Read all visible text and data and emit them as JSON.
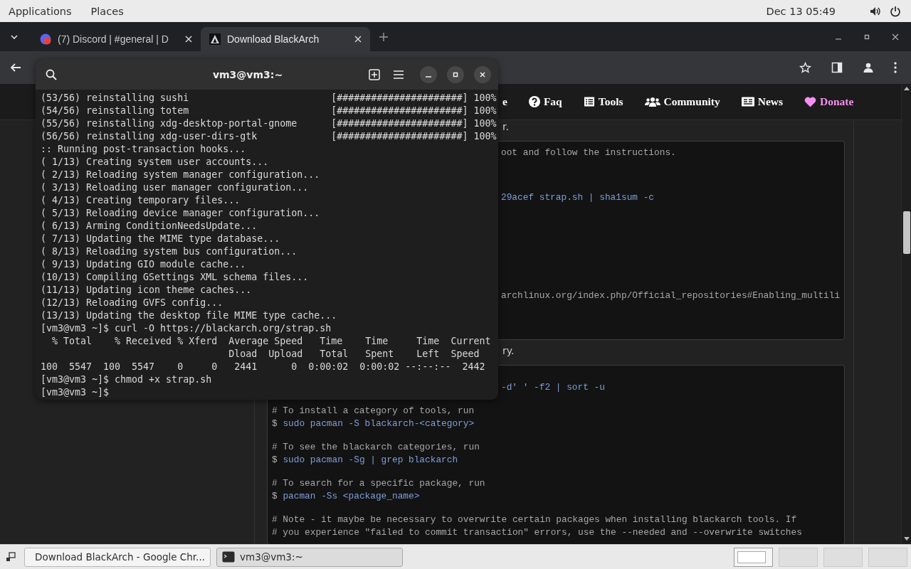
{
  "top_bar": {
    "menus": [
      "Applications",
      "Places"
    ],
    "clock": "Dec 13  05:49"
  },
  "browser": {
    "tabs": [
      {
        "title": "(7) Discord | #general | D",
        "kind": "discord",
        "selected": false
      },
      {
        "title": "Download BlackArch",
        "kind": "blackarch",
        "selected": true
      }
    ],
    "nav": [
      {
        "label": "e",
        "kind": "partial",
        "color": "#ffffff"
      },
      {
        "label": "Faq",
        "kind": "faq",
        "color": "#ffffff"
      },
      {
        "label": "Tools",
        "kind": "tools",
        "color": "#ffffff"
      },
      {
        "label": "Community",
        "kind": "community",
        "color": "#ffffff"
      },
      {
        "label": "News",
        "kind": "news",
        "color": "#ffffff"
      },
      {
        "label": "Donate",
        "kind": "donate",
        "color": "#f590f0"
      }
    ],
    "sections": [
      {
        "kind": "text",
        "text": "r."
      },
      {
        "kind": "code",
        "lines": [
          {
            "kind": "comment-tail",
            "text": "oot and follow the instructions."
          },
          {
            "kind": "blank"
          },
          {
            "kind": "blank"
          },
          {
            "kind": "blank"
          },
          {
            "kind": "command-tail",
            "text": "29acef strap.sh | sha1sum -c"
          },
          {
            "kind": "blank"
          },
          {
            "kind": "blank"
          },
          {
            "kind": "blank"
          },
          {
            "kind": "blank"
          },
          {
            "kind": "blank"
          },
          {
            "kind": "blank"
          },
          {
            "kind": "blank"
          },
          {
            "kind": "blank"
          },
          {
            "kind": "comment-tail",
            "text": "archlinux.org/index.php/Official_repositories#Enabling_multili"
          },
          {
            "kind": "blank"
          },
          {
            "kind": "blank"
          },
          {
            "kind": "blank"
          }
        ]
      },
      {
        "kind": "text",
        "text": "ry."
      },
      {
        "kind": "code",
        "lines": [
          {
            "kind": "blank"
          },
          {
            "kind": "command-tail",
            "text": "-d' ' -f2 | sort -u"
          },
          {
            "kind": "blank"
          },
          {
            "kind": "comment",
            "text": "# To install a category of tools, run"
          },
          {
            "kind": "command",
            "prompt": "$",
            "text": "sudo pacman -S blackarch-<category>"
          },
          {
            "kind": "blank"
          },
          {
            "kind": "comment",
            "text": "# To see the blackarch categories, run"
          },
          {
            "kind": "command",
            "prompt": "$",
            "text": "sudo pacman -Sg | grep blackarch"
          },
          {
            "kind": "blank"
          },
          {
            "kind": "comment",
            "text": "# To search for a specific package, run"
          },
          {
            "kind": "command",
            "prompt": "$",
            "text": "pacman -Ss <package_name>"
          },
          {
            "kind": "blank"
          },
          {
            "kind": "comment",
            "text": "# Note - it maybe be necessary to overwrite certain packages when installing blackarch tools. If"
          },
          {
            "kind": "comment",
            "text": "# you experience \"failed to commit transaction\" errors, use the --needed and --overwrite switches"
          }
        ]
      }
    ]
  },
  "terminal": {
    "title": "vm3@vm3:~",
    "lines": [
      "(53/56) reinstalling sushi                         [######################] 100%",
      "(54/56) reinstalling totem                         [######################] 100%",
      "(55/56) reinstalling xdg-desktop-portal-gnome      [######################] 100%",
      "(56/56) reinstalling xdg-user-dirs-gtk             [######################] 100%",
      ":: Running post-transaction hooks...",
      "( 1/13) Creating system user accounts...",
      "( 2/13) Reloading system manager configuration...",
      "( 3/13) Reloading user manager configuration...",
      "( 4/13) Creating temporary files...",
      "( 5/13) Reloading device manager configuration...",
      "( 6/13) Arming ConditionNeedsUpdate...",
      "( 7/13) Updating the MIME type database...",
      "( 8/13) Reloading system bus configuration...",
      "( 9/13) Updating GIO module cache...",
      "(10/13) Compiling GSettings XML schema files...",
      "(11/13) Updating icon theme caches...",
      "(12/13) Reloading GVFS config...",
      "(13/13) Updating the desktop file MIME type cache...",
      "[vm3@vm3 ~]$ curl -O https://blackarch.org/strap.sh",
      "  % Total    % Received % Xferd  Average Speed   Time    Time     Time  Current",
      "                                 Dload  Upload   Total   Spent    Left  Speed",
      "100  5547  100  5547    0     0   2441      0  0:00:02  0:00:02 --:--:--  2442",
      "[vm3@vm3 ~]$ chmod +x strap.sh",
      "[vm3@vm3 ~]$"
    ]
  },
  "taskbar": {
    "windows": [
      {
        "title": "Download BlackArch - Google Chr...",
        "kind": "browser",
        "selected": false
      },
      {
        "title": "vm3@vm3:~",
        "kind": "terminal",
        "selected": true
      }
    ],
    "workspaces": [
      {
        "selected": true
      },
      {
        "selected": false
      },
      {
        "selected": false
      },
      {
        "selected": false
      }
    ]
  }
}
